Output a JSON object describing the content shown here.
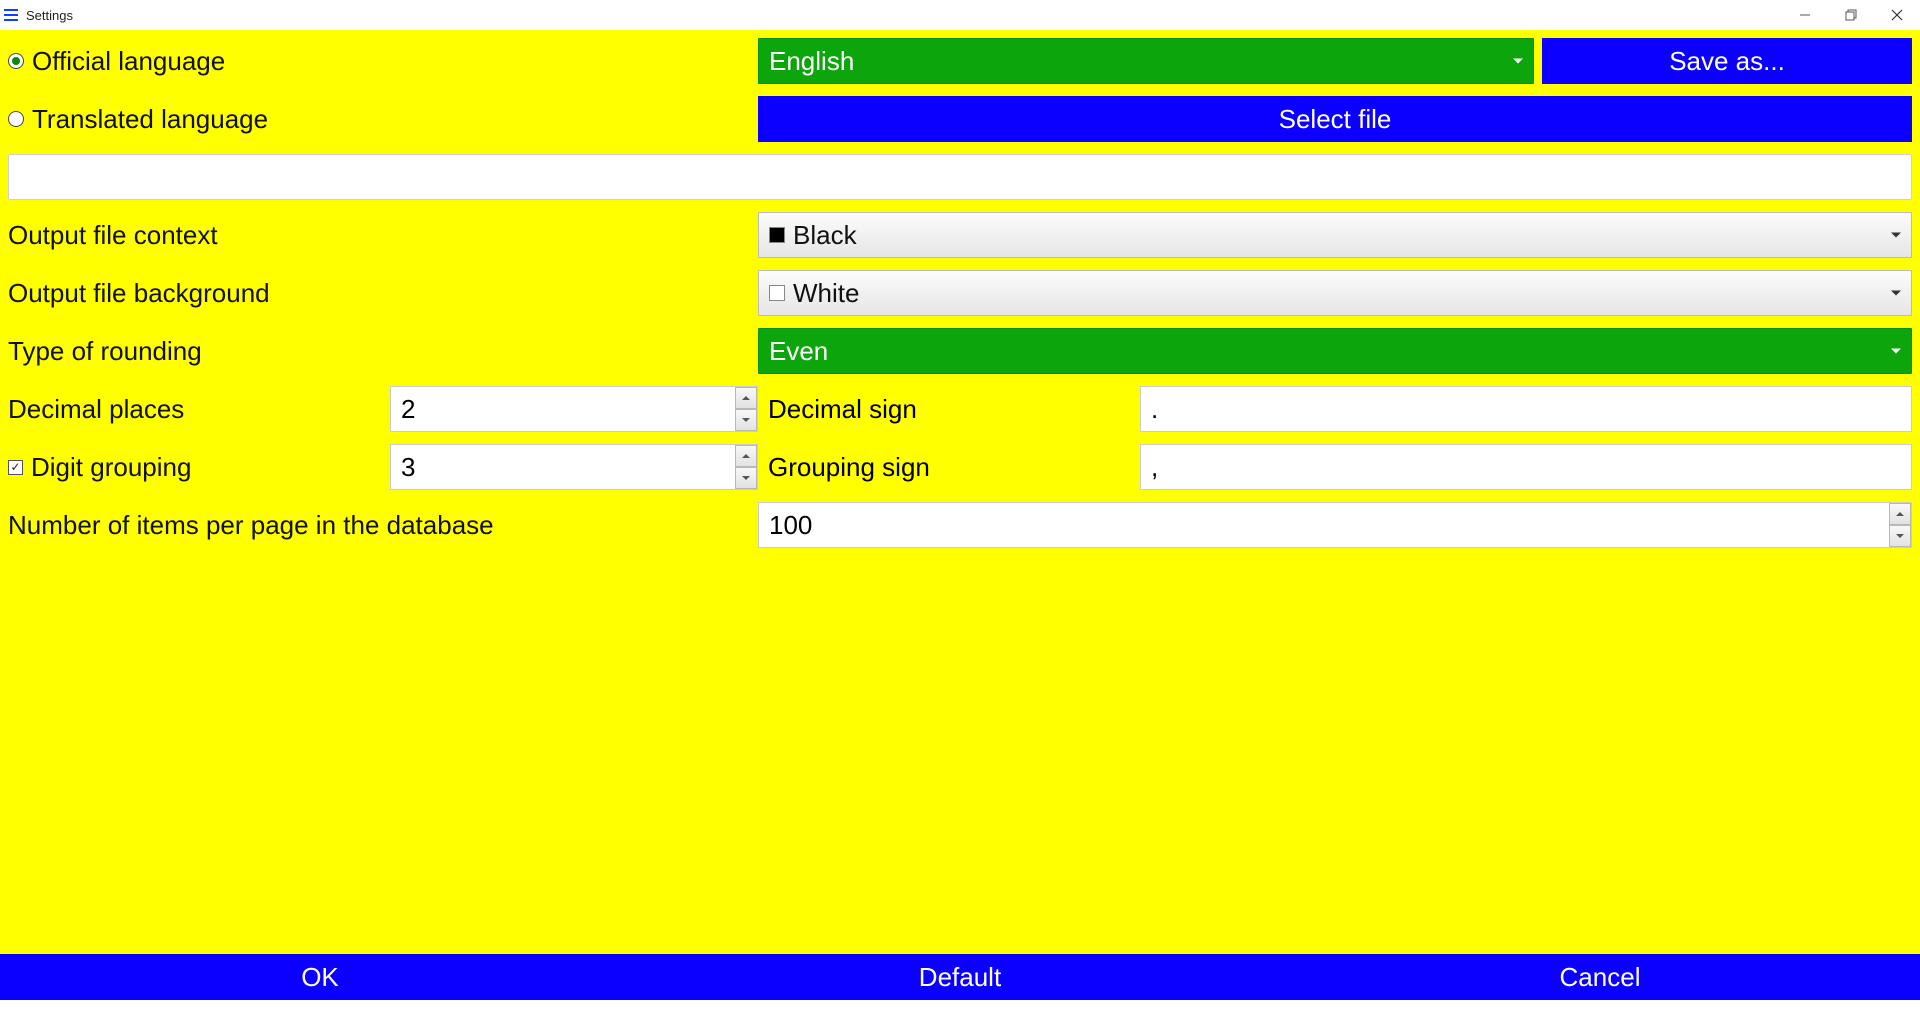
{
  "window": {
    "title": "Settings"
  },
  "rows": {
    "official_language": {
      "label": "Official language",
      "value": "English"
    },
    "save_as_label": "Save as...",
    "translated_language": {
      "label": "Translated language"
    },
    "select_file_label": "Select file",
    "output_context": {
      "label": "Output file context",
      "value": "Black"
    },
    "output_background": {
      "label": "Output file background",
      "value": "White"
    },
    "rounding": {
      "label": "Type of rounding",
      "value": "Even"
    },
    "decimal_places": {
      "label": "Decimal places",
      "value": "2"
    },
    "decimal_sign": {
      "label": "Decimal sign",
      "value": "."
    },
    "digit_grouping": {
      "label": "Digit grouping",
      "value": "3",
      "checked": true
    },
    "grouping_sign": {
      "label": "Grouping sign",
      "value": ","
    },
    "items_per_page": {
      "label": "Number of items per page in the database",
      "value": "100"
    }
  },
  "footer": {
    "ok": "OK",
    "default": "Default",
    "cancel": "Cancel"
  }
}
